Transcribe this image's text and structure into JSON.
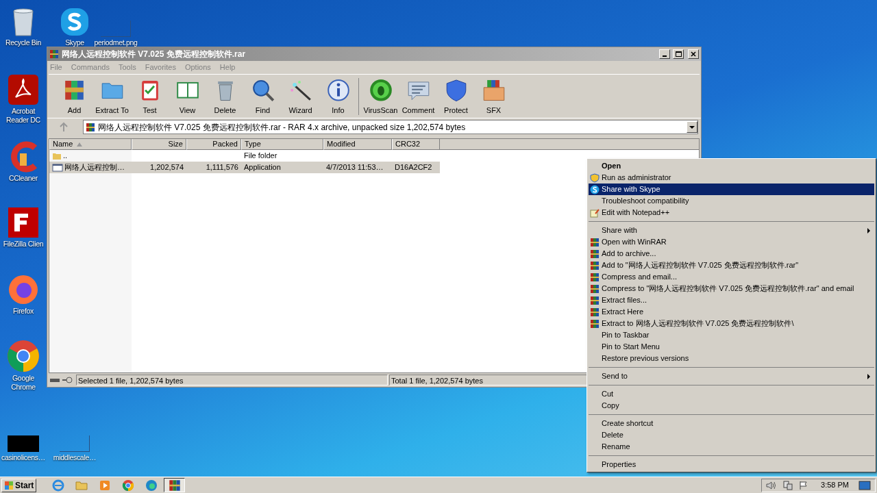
{
  "desktop_icons": [
    {
      "label": "Recycle Bin",
      "kind": "trash"
    },
    {
      "label": "Skype",
      "kind": "skype"
    },
    {
      "label": "periodmet.png",
      "kind": "blank"
    },
    {
      "label": "Acrobat Reader DC",
      "kind": "pdf"
    },
    {
      "label": "CCleaner",
      "kind": "ccleaner"
    },
    {
      "label": "FileZilla Clien",
      "kind": "filezilla"
    },
    {
      "label": "Firefox",
      "kind": "firefox"
    },
    {
      "label": "Google Chrome",
      "kind": "chrome"
    },
    {
      "label": "casinolicens…",
      "kind": "black"
    },
    {
      "label": "middlescale…",
      "kind": "blank"
    }
  ],
  "window": {
    "title": "网络人远程控制软件 V7.025 免费远程控制软件.rar",
    "menu": [
      "File",
      "Commands",
      "Tools",
      "Favorites",
      "Options",
      "Help"
    ],
    "toolbar": [
      [
        {
          "label": "Add",
          "kind": "add"
        },
        {
          "label": "Extract To",
          "kind": "extract"
        },
        {
          "label": "Test",
          "kind": "test"
        },
        {
          "label": "View",
          "kind": "view"
        },
        {
          "label": "Delete",
          "kind": "delete"
        },
        {
          "label": "Find",
          "kind": "find"
        },
        {
          "label": "Wizard",
          "kind": "wizard"
        },
        {
          "label": "Info",
          "kind": "info"
        }
      ],
      [
        {
          "label": "VirusScan",
          "kind": "virus"
        },
        {
          "label": "Comment",
          "kind": "comment"
        },
        {
          "label": "Protect",
          "kind": "protect"
        },
        {
          "label": "SFX",
          "kind": "sfx"
        }
      ]
    ],
    "address": "网络人远程控制软件 V7.025 免费远程控制软件.rar - RAR 4.x archive, unpacked size 1,202,574 bytes",
    "columns": [
      "Name",
      "Size",
      "Packed",
      "Type",
      "Modified",
      "CRC32"
    ],
    "rows": [
      {
        "kind": "folder",
        "name": "..",
        "size": "",
        "packed": "",
        "type": "File folder",
        "modified": "",
        "crc32": "",
        "selected": false
      },
      {
        "kind": "app",
        "name": "网络人远程控制…",
        "size": "1,202,574",
        "packed": "1,111,576",
        "type": "Application",
        "modified": "4/7/2013 11:53…",
        "crc32": "D16A2CF2",
        "selected": true
      }
    ],
    "status": {
      "left": "Selected 1 file, 1,202,574 bytes",
      "right": "Total 1 file, 1,202,574 bytes"
    }
  },
  "context_menu": [
    [
      {
        "label": "Open",
        "default": true,
        "selected": false,
        "submenu": false
      },
      {
        "label": "Run as administrator",
        "kind": "shield",
        "default": false,
        "selected": false,
        "submenu": false
      },
      {
        "label": "Share with Skype",
        "kind": "skype",
        "default": false,
        "selected": true,
        "submenu": false
      },
      {
        "label": "Troubleshoot compatibility",
        "default": false,
        "selected": false,
        "submenu": false
      },
      {
        "label": "Edit with Notepad++",
        "kind": "notepad",
        "default": false,
        "selected": false,
        "submenu": false
      }
    ],
    [
      {
        "label": "Share with",
        "default": false,
        "selected": false,
        "submenu": true
      },
      {
        "label": "Open with WinRAR",
        "kind": "winrar",
        "default": false,
        "selected": false,
        "submenu": false
      },
      {
        "label": "Add to archive...",
        "kind": "winrar",
        "default": false,
        "selected": false,
        "submenu": false
      },
      {
        "label": "Add to \"网络人远程控制软件 V7.025 免费远程控制软件.rar\"",
        "kind": "winrar",
        "default": false,
        "selected": false,
        "submenu": false
      },
      {
        "label": "Compress and email...",
        "kind": "winrar",
        "default": false,
        "selected": false,
        "submenu": false
      },
      {
        "label": "Compress to \"网络人远程控制软件 V7.025 免费远程控制软件.rar\" and email",
        "kind": "winrar",
        "default": false,
        "selected": false,
        "submenu": false
      },
      {
        "label": "Extract files...",
        "kind": "winrar",
        "default": false,
        "selected": false,
        "submenu": false
      },
      {
        "label": "Extract Here",
        "kind": "winrar",
        "default": false,
        "selected": false,
        "submenu": false
      },
      {
        "label": "Extract to 网络人远程控制软件 V7.025 免费远程控制软件\\",
        "kind": "winrar",
        "default": false,
        "selected": false,
        "submenu": false
      },
      {
        "label": "Pin to Taskbar",
        "default": false,
        "selected": false,
        "submenu": false
      },
      {
        "label": "Pin to Start Menu",
        "default": false,
        "selected": false,
        "submenu": false
      },
      {
        "label": "Restore previous versions",
        "default": false,
        "selected": false,
        "submenu": false
      }
    ],
    [
      {
        "label": "Send to",
        "default": false,
        "selected": false,
        "submenu": true
      }
    ],
    [
      {
        "label": "Cut",
        "default": false,
        "selected": false,
        "submenu": false
      },
      {
        "label": "Copy",
        "default": false,
        "selected": false,
        "submenu": false
      }
    ],
    [
      {
        "label": "Create shortcut",
        "default": false,
        "selected": false,
        "submenu": false
      },
      {
        "label": "Delete",
        "default": false,
        "selected": false,
        "submenu": false
      },
      {
        "label": "Rename",
        "default": false,
        "selected": false,
        "submenu": false
      }
    ],
    [
      {
        "label": "Properties",
        "default": false,
        "selected": false,
        "submenu": false
      }
    ]
  ],
  "taskbar": {
    "start": "Start",
    "apps": [
      {
        "kind": "ie",
        "active": false
      },
      {
        "kind": "explorer",
        "active": false
      },
      {
        "kind": "media",
        "active": false
      },
      {
        "kind": "chrome",
        "active": false
      },
      {
        "kind": "edge",
        "active": false
      },
      {
        "kind": "winrar",
        "active": true
      }
    ],
    "time": "3:58 PM"
  }
}
